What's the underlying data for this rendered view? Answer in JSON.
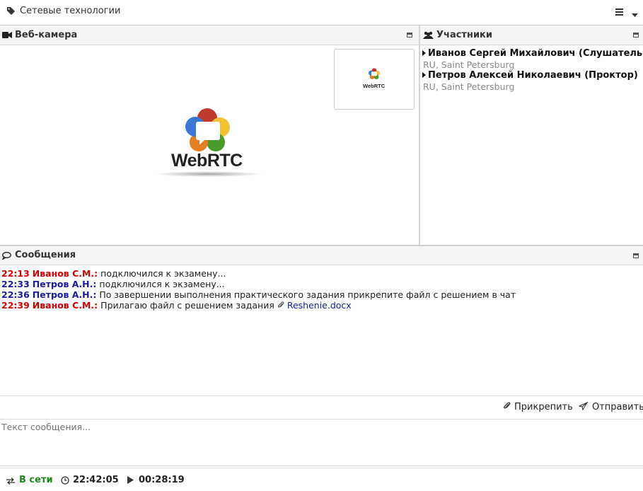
{
  "topbar": {
    "title": "Сетевые технологии",
    "tag_icon": "tag-icon",
    "menu_icon": "menu-icon"
  },
  "webcam": {
    "title": "Веб-камера",
    "icon": "video-camera-icon",
    "logo_text": "WebRTC",
    "thumb_logo_text": "WebRTC"
  },
  "participants": {
    "title": "Участники",
    "icon": "users-icon",
    "items": [
      {
        "name": "Иванов Сергей Михайлович (Слушатель)",
        "location": "RU, Saint Petersburg"
      },
      {
        "name": "Петров Алексей Николаевич (Проктор)",
        "location": "RU, Saint Petersburg"
      }
    ]
  },
  "messages": {
    "title": "Сообщения",
    "icon": "chat-icon",
    "items": [
      {
        "time": "22:13",
        "author": "Иванов С.М.:",
        "text": "подключился к экзамену...",
        "role": "ivanov"
      },
      {
        "time": "22:33",
        "author": "Петров А.Н.:",
        "text": "подключился к экзамену...",
        "role": "petrov"
      },
      {
        "time": "22:36",
        "author": "Петров А.Н.:",
        "text": "По завершении выполнения практического задания прикрепите файл с решением в чат",
        "role": "petrov"
      },
      {
        "time": "22:39",
        "author": "Иванов С.М.:",
        "text": "Прилагаю файл с решением задания",
        "attachment": "Reshenie.docx",
        "role": "ivanov"
      }
    ],
    "attach_label": "Прикрепить",
    "send_label": "Отправить",
    "input_placeholder": "Текст сообщения..."
  },
  "statusbar": {
    "status": "В сети",
    "clock": "22:42:05",
    "timer": "00:28:19"
  },
  "colors": {
    "ivanov": "#d40000",
    "petrov": "#1a1aa6",
    "online": "#1e8a1e",
    "link": "#1a1aa6"
  }
}
